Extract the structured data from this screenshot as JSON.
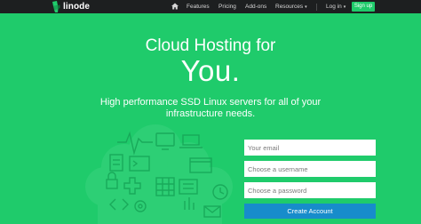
{
  "nav": {
    "logo_text": "linode",
    "home_icon": "home-icon",
    "items": [
      {
        "label": "Features"
      },
      {
        "label": "Pricing"
      },
      {
        "label": "Add-ons"
      },
      {
        "label": "Resources"
      }
    ],
    "login_label": "Log in",
    "signup_label": "Sign up"
  },
  "hero": {
    "line1": "Cloud Hosting for",
    "line2": "You.",
    "subtitle": "High performance SSD Linux servers for all of your infrastructure needs."
  },
  "form": {
    "email_placeholder": "Your email",
    "username_placeholder": "Choose a username",
    "password_placeholder": "Choose a password",
    "submit_label": "Create Account"
  },
  "colors": {
    "background": "#1fcb6b",
    "navbar": "#1d1f20",
    "signup_button": "#1fcb6b",
    "create_button": "#178ccb"
  }
}
